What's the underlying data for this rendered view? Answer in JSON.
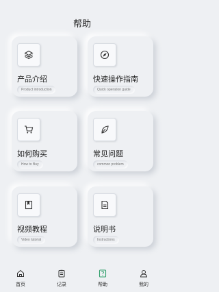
{
  "header": {
    "title": "帮助"
  },
  "cards": [
    {
      "title": "产品介绍",
      "subtitle": "Product introduction",
      "icon": "layers-icon"
    },
    {
      "title": "快速操作指南",
      "subtitle": "Quick operation guide",
      "icon": "compass-icon"
    },
    {
      "title": "如何购买",
      "subtitle": "How to Buy",
      "icon": "cart-icon"
    },
    {
      "title": "常见问题",
      "subtitle": "common problem",
      "icon": "leaf-icon"
    },
    {
      "title": "视频教程",
      "subtitle": "Video tutorial",
      "icon": "book-icon"
    },
    {
      "title": "说明书",
      "subtitle": "Instructions",
      "icon": "document-icon"
    }
  ],
  "tabbar": {
    "items": [
      {
        "label": "首页",
        "icon": "home-icon",
        "active": false
      },
      {
        "label": "记录",
        "icon": "record-icon",
        "active": false
      },
      {
        "label": "帮助",
        "icon": "help-icon",
        "active": true
      },
      {
        "label": "我的",
        "icon": "profile-icon",
        "active": false
      }
    ]
  },
  "colors": {
    "background": "#eef0f3",
    "accent_green": "#2f9e6a",
    "text": "#222222"
  }
}
